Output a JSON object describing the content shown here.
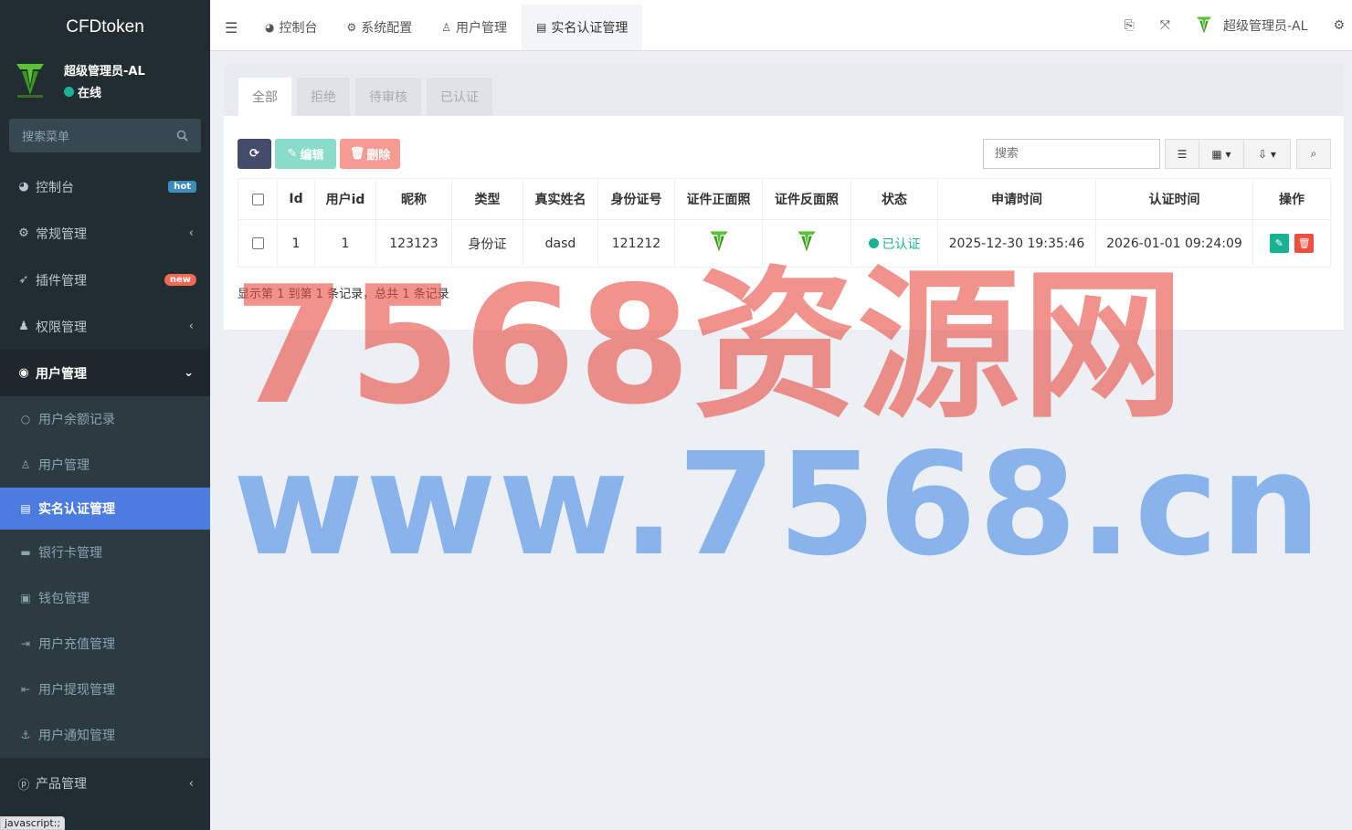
{
  "app": {
    "brand": "CFDtoken"
  },
  "user": {
    "name": "超级管理员-AL",
    "status": "在线"
  },
  "sidebar": {
    "search_placeholder": "搜索菜单",
    "items": [
      {
        "label": "控制台",
        "icon": "dashboard-icon",
        "badge": "hot"
      },
      {
        "label": "常规管理",
        "icon": "cogs-icon"
      },
      {
        "label": "插件管理",
        "icon": "rocket-icon",
        "badge": "new"
      },
      {
        "label": "权限管理",
        "icon": "group-icon"
      },
      {
        "label": "用户管理",
        "icon": "user-circle-icon"
      }
    ],
    "subitems": [
      {
        "label": "用户余额记录",
        "icon": "circle-o-icon"
      },
      {
        "label": "用户管理",
        "icon": "user-icon"
      },
      {
        "label": "实名认证管理",
        "icon": "id-card-icon"
      },
      {
        "label": "银行卡管理",
        "icon": "credit-card-icon"
      },
      {
        "label": "钱包管理",
        "icon": "wallet-icon"
      },
      {
        "label": "用户充值管理",
        "icon": "sign-in-icon"
      },
      {
        "label": "用户提现管理",
        "icon": "sign-out-icon"
      },
      {
        "label": "用户通知管理",
        "icon": "anchor-icon"
      }
    ],
    "product": {
      "label": "产品管理",
      "icon": "product-icon"
    }
  },
  "status_tip": "javascript:;",
  "topnav": {
    "tabs": [
      {
        "label": "控制台",
        "icon": "dashboard-icon"
      },
      {
        "label": "系统配置",
        "icon": "gear-icon"
      },
      {
        "label": "用户管理",
        "icon": "user-icon"
      },
      {
        "label": "实名认证管理",
        "icon": "id-card-icon"
      }
    ],
    "user_name": "超级管理员-AL"
  },
  "panel": {
    "tabs": [
      "全部",
      "拒绝",
      "待审核",
      "已认证"
    ],
    "toolbar": {
      "edit_label": "编辑",
      "delete_label": "删除",
      "search_placeholder": "搜索"
    },
    "columns": [
      "Id",
      "用户id",
      "昵称",
      "类型",
      "真实姓名",
      "身份证号",
      "证件正面照",
      "证件反面照",
      "状态",
      "申请时间",
      "认证时间",
      "操作"
    ],
    "rows": [
      {
        "id": "1",
        "user_id": "1",
        "nickname": "123123",
        "type": "身份证",
        "real_name": "dasd",
        "id_number": "121212",
        "status": "已认证",
        "apply_time": "2025-12-30 19:35:46",
        "verify_time": "2026-01-01 09:24:09"
      }
    ],
    "records_text": "显示第 1 到第 1 条记录，总共 1 条记录"
  },
  "watermark": {
    "line1": "7568资源网",
    "line2": "www.7568.cn"
  },
  "colors": {
    "sidebar_bg": "#222d32",
    "active_item": "#4c7ce0",
    "success": "#19b394",
    "danger": "#f04e3e"
  }
}
